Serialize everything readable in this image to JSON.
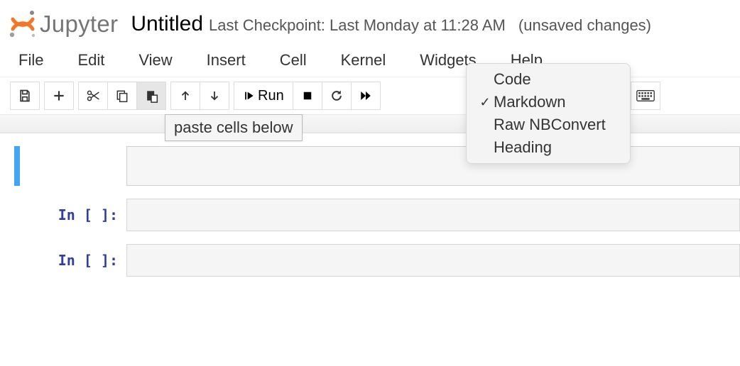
{
  "header": {
    "logo_text": "Jupyter",
    "title": "Untitled",
    "checkpoint": "Last Checkpoint: Last Monday at 11:28 AM",
    "unsaved": "(unsaved changes)"
  },
  "menu": {
    "file": "File",
    "edit": "Edit",
    "view": "View",
    "insert": "Insert",
    "cell": "Cell",
    "kernel": "Kernel",
    "widgets": "Widgets",
    "help": "Help"
  },
  "toolbar": {
    "tooltip_paste": "paste cells below",
    "run_label": "Run"
  },
  "celltype_dropdown": {
    "selected": "Markdown",
    "options": {
      "code": "Code",
      "markdown": "Markdown",
      "raw": "Raw NBConvert",
      "heading": "Heading"
    }
  },
  "cells": {
    "c0_prompt": "",
    "c1_prompt": "In [ ]:",
    "c2_prompt": "In [ ]:"
  }
}
